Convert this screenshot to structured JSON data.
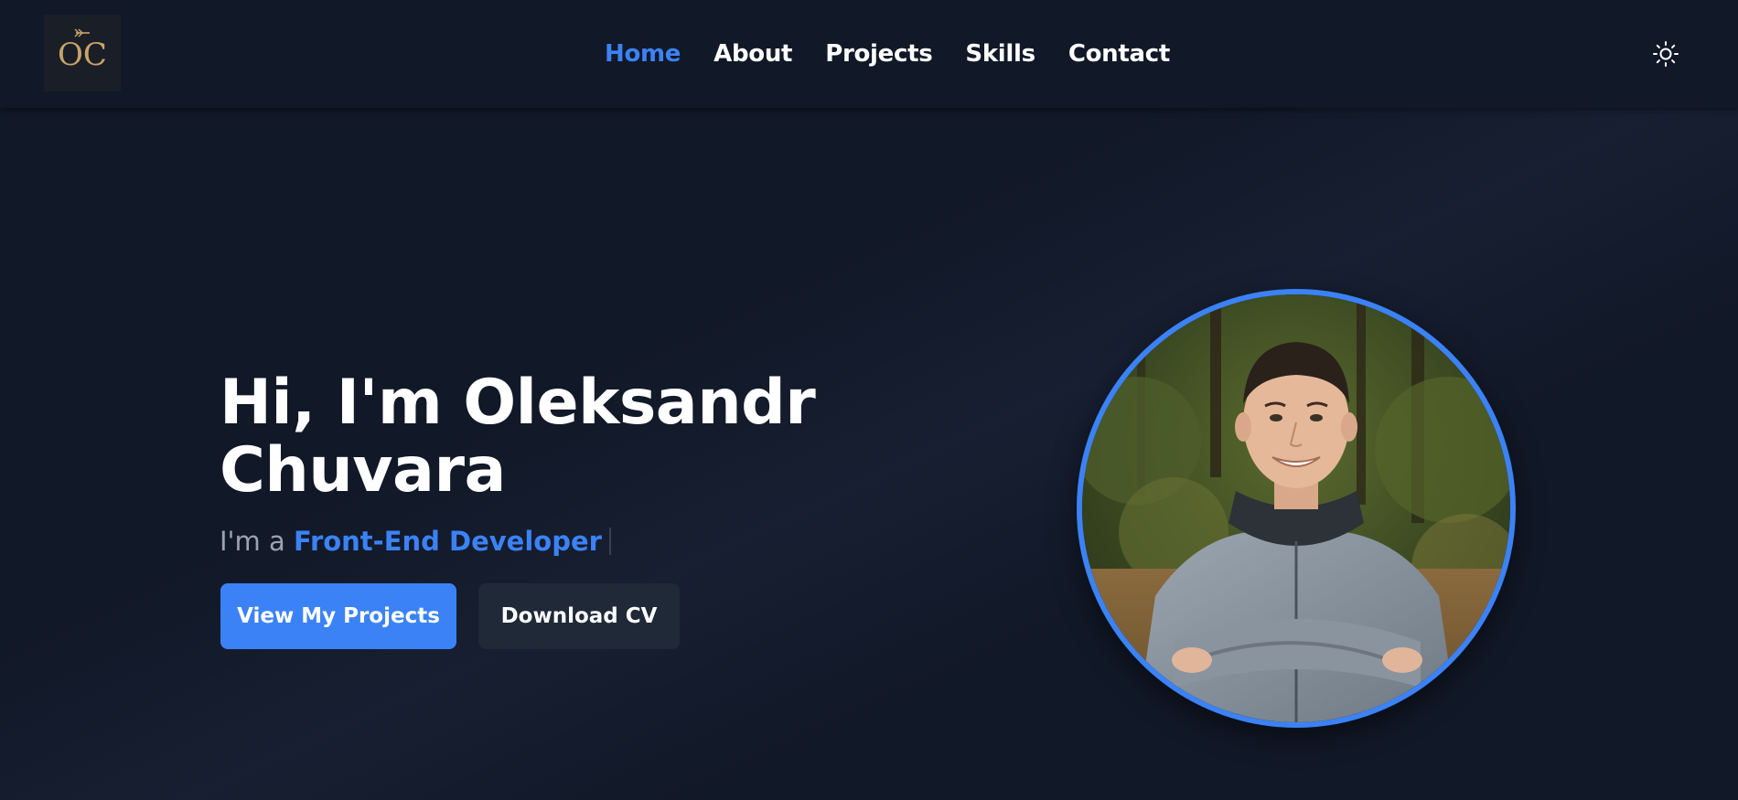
{
  "logo": {
    "text": "OC",
    "color": "#c9a46a"
  },
  "nav": {
    "items": [
      {
        "label": "Home",
        "active": true
      },
      {
        "label": "About",
        "active": false
      },
      {
        "label": "Projects",
        "active": false
      },
      {
        "label": "Skills",
        "active": false
      },
      {
        "label": "Contact",
        "active": false
      }
    ]
  },
  "theme_toggle": {
    "icon": "sun-icon"
  },
  "hero": {
    "title_line1": "Hi, I'm Oleksandr",
    "title_line2": "Chuvara",
    "tagline_prefix": "I'm a ",
    "tagline_role": "Front-End Developer",
    "primary_button": "View My Projects",
    "secondary_button": "Download CV"
  },
  "colors": {
    "background": "#111827",
    "accent": "#3b82f6",
    "secondary_button": "#1f2937",
    "muted_text": "#9ca3af"
  },
  "avatar": {
    "description_icon": "profile-photo"
  }
}
